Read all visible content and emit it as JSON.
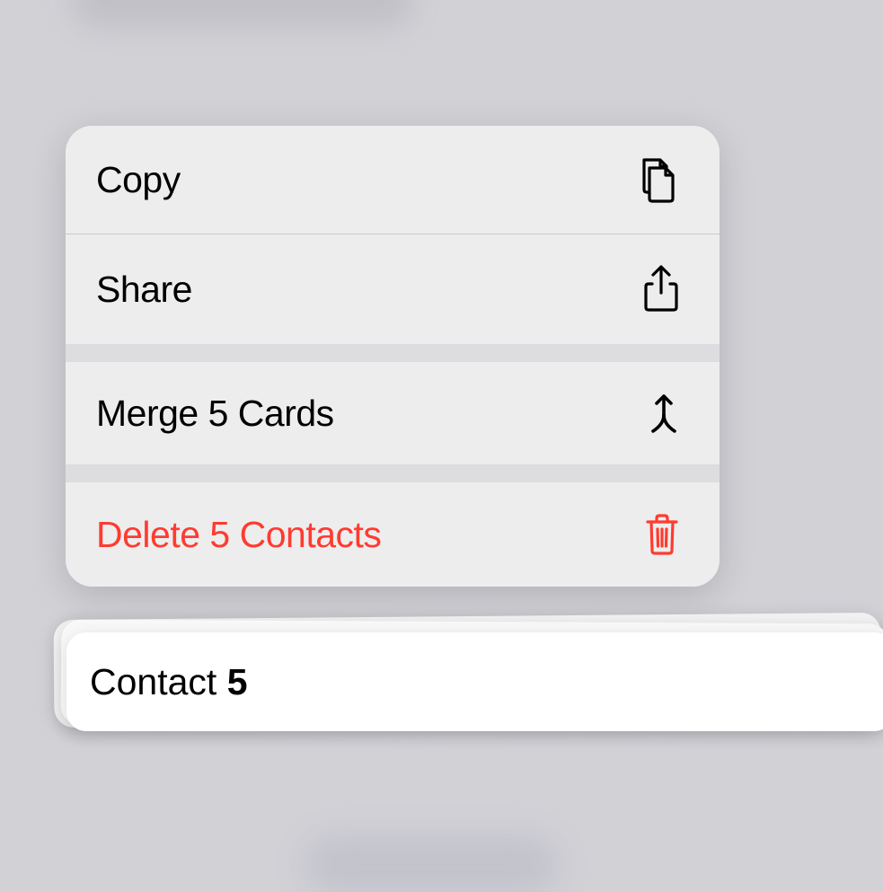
{
  "menu": {
    "copy": {
      "label": "Copy"
    },
    "share": {
      "label": "Share"
    },
    "merge": {
      "label": "Merge 5 Cards"
    },
    "delete": {
      "label": "Delete 5 Contacts"
    }
  },
  "stack": {
    "top_card_label_prefix": "Contact ",
    "top_card_label_number": "5"
  },
  "colors": {
    "destructive": "#ff3b30"
  }
}
